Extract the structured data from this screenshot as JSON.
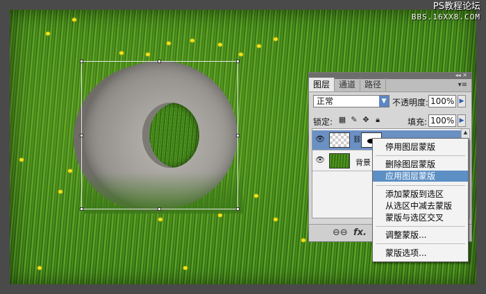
{
  "watermark": {
    "line1": "PS教程论坛",
    "line2": "BBS.16XX8.COM"
  },
  "layers_panel": {
    "tabs": [
      {
        "label": "图层",
        "active": true
      },
      {
        "label": "通道",
        "active": false
      },
      {
        "label": "路径",
        "active": false
      }
    ],
    "blend_mode": "正常",
    "opacity_label": "不透明度:",
    "opacity_value": "100%",
    "lock_label": "锁定:",
    "fill_label": "填充:",
    "fill_value": "100%",
    "layers": [
      {
        "name": "",
        "thumb": "transparent",
        "has_mask": true,
        "selected": true
      },
      {
        "name": "背景",
        "thumb": "grass",
        "has_mask": false,
        "selected": false
      }
    ],
    "bottom_icons": [
      "link-icon",
      "fx-icon",
      "mask-icon"
    ]
  },
  "context_menu": {
    "items": [
      {
        "label": "停用图层蒙版",
        "highlighted": false
      },
      {
        "label": "删除图层蒙版",
        "highlighted": false
      },
      {
        "label": "应用图层蒙版",
        "highlighted": true
      },
      {
        "label": "添加蒙版到选区",
        "highlighted": false
      },
      {
        "label": "从选区中减去蒙版",
        "highlighted": false
      },
      {
        "label": "蒙版与选区交叉",
        "highlighted": false
      },
      {
        "label": "调整蒙版...",
        "highlighted": false
      },
      {
        "label": "蒙版选项...",
        "highlighted": false
      }
    ]
  },
  "colors": {
    "accent": "#5c8fc4",
    "panel_bg": "#d6d6d6",
    "grass": "#3d7f1a"
  }
}
